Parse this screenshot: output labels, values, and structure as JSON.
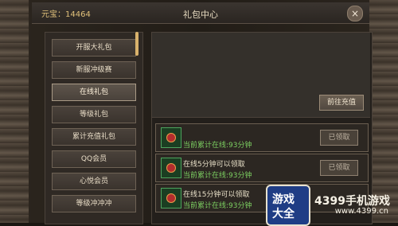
{
  "header": {
    "currency": "元宝：14464",
    "title": "礼包中心",
    "close_icon": "close-icon"
  },
  "sidebar": {
    "items": [
      {
        "label": "开服大礼包"
      },
      {
        "label": "新服冲级赛"
      },
      {
        "label": "在线礼包",
        "selected": true
      },
      {
        "label": "等级礼包"
      },
      {
        "label": "累计充值礼包"
      },
      {
        "label": "QQ会员"
      },
      {
        "label": "心悦会员"
      },
      {
        "label": "等级冲冲冲"
      }
    ]
  },
  "content": {
    "recharge_button": "前往充值",
    "rows": [
      {
        "title": "",
        "subtitle": "当前累计在线:93分钟",
        "button": "已领取"
      },
      {
        "title": "在线5分钟可以领取",
        "subtitle": "当前累计在线:93分钟",
        "button": "已领取"
      },
      {
        "title": "在线15分钟可以领取",
        "subtitle": "当前累计在线:93分钟",
        "button": ""
      }
    ]
  },
  "branding": {
    "logo_line1": "游戏",
    "logo_line2": "大全",
    "watermark": "4399手机游戏",
    "watermark_url": "www.4399.cn"
  }
}
